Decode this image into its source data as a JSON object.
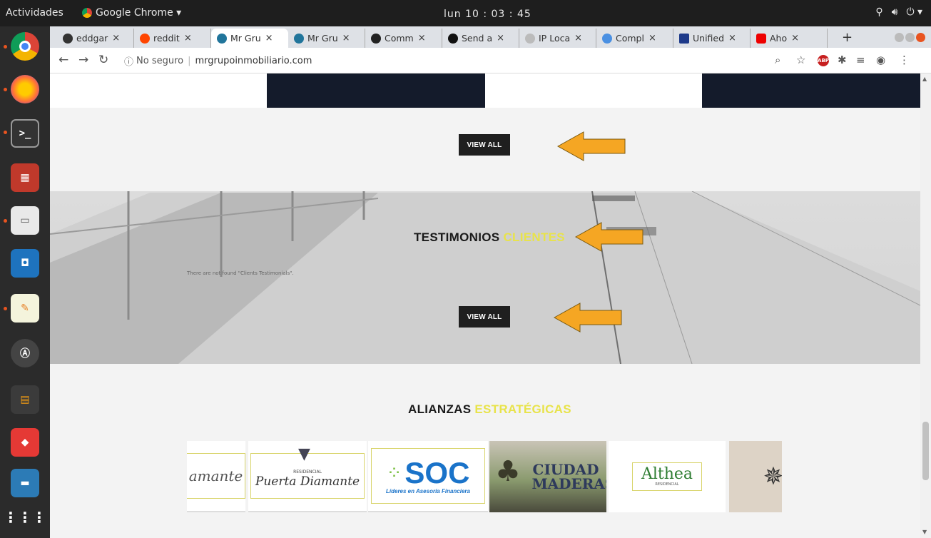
{
  "topbar": {
    "activities": "Actividades",
    "app_name": "Google Chrome ▾",
    "clock": "lun 10 : 03 : 45"
  },
  "tabs": [
    {
      "label": "eddgar",
      "icon_color": "#333"
    },
    {
      "label": "reddit",
      "icon_color": "#ff4500"
    },
    {
      "label": "Mr Gru",
      "icon_color": "#21759b"
    },
    {
      "label": "Mr Gru",
      "icon_color": "#21759b"
    },
    {
      "label": "Comm",
      "icon_color": "#222"
    },
    {
      "label": "Send a",
      "icon_color": "#111"
    },
    {
      "label": "IP Loca",
      "icon_color": "#888"
    },
    {
      "label": "Compl",
      "icon_color": "#4a90e2"
    },
    {
      "label": "Unified",
      "icon_color": "#1e3a8a"
    },
    {
      "label": "Aho",
      "icon_color": "#e00"
    }
  ],
  "toolbar": {
    "security_label": "No seguro",
    "url": "mrgrupoinmobiliario.com"
  },
  "page": {
    "view_all_1": "VIEW ALL",
    "view_all_2": "VIEW ALL",
    "testimonios_a": "TESTIMONIOS ",
    "testimonios_b": "CLIENTES",
    "empty_note": "There are not found \"Clients Testimonials\".",
    "alianzas_a": "ALIANZAS ",
    "alianzas_b": "ESTRATÉGICAS",
    "logos": [
      {
        "text": "amante"
      },
      {
        "text": "Puerta Diamante",
        "sub": "RESIDENCIAL"
      },
      {
        "text": "SOC",
        "sub": "Líderes en Asesoría Financiera"
      },
      {
        "text": "CIUDAD MADERAS"
      },
      {
        "text": "Althea",
        "sub": "RESIDENCIAL"
      },
      {
        "text": ""
      }
    ]
  },
  "colors": {
    "accent_yellow": "#e8e34a",
    "arrow_orange": "#f5a623",
    "dark_navy": "#141b2b"
  }
}
